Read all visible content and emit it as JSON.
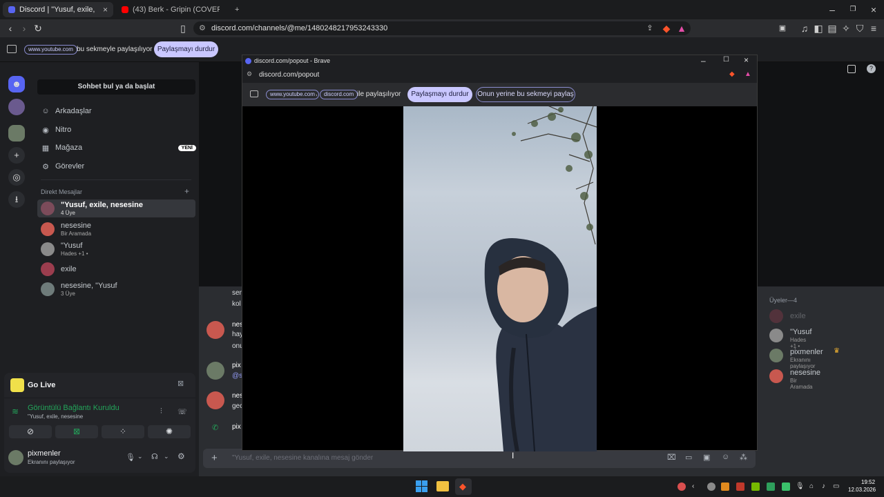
{
  "tabs": [
    {
      "title": "Discord | \"Yusuf, exile, nesesine",
      "active": true
    },
    {
      "title": "(43) Berk - Gripin (COVER) - YouT",
      "active": false
    }
  ],
  "browser": {
    "url": "discord.com/channels/@me/1480248217953243330"
  },
  "sharebar": {
    "site_pill": "www.youtube.com",
    "text": "bu sekmeyle paylaşılıyor",
    "stop_button": "Paylaşmayı durdur"
  },
  "sidebar": {
    "finder": "Sohbet bul ya da başlat",
    "nav": [
      "Arkadaşlar",
      "Nitro",
      "Mağaza",
      "Görevler"
    ],
    "new_badge": "YENİ",
    "dm_header": "Direkt Mesajlar",
    "dm_add": "+",
    "dms": [
      {
        "name": "\"Yusuf, exile, nesesine",
        "sub": "4 Üye"
      },
      {
        "name": "nesesine",
        "sub": "Bir Aramada"
      },
      {
        "name": "\"Yusuf",
        "sub": "Hades +1 •"
      },
      {
        "name": "exile",
        "sub": ""
      },
      {
        "name": "nesesine, \"Yusuf",
        "sub": "3 Üye"
      }
    ]
  },
  "golive": {
    "title": "Go Live",
    "status": "Görüntülü Bağlantı Kuruldu",
    "channel": "\"Yusuf, exile, nesesine"
  },
  "user": {
    "name": "pixmenler",
    "status": "Ekranını paylaşıyor"
  },
  "chat": {
    "snippets": [
      "sen",
      "kol",
      "nes",
      "hay",
      "onu",
      "pix",
      "@s",
      "nes",
      "gec",
      "pix"
    ],
    "input_placeholder": "\"Yusuf, exile, nesesine kanalına mesaj gönder"
  },
  "members": {
    "header": "Üyeler—4",
    "list": [
      {
        "name": "exile",
        "sub": ""
      },
      {
        "name": "\"Yusuf",
        "sub": "Hades +1 •"
      },
      {
        "name": "pixmenler",
        "sub": "Ekranını paylaşıyor"
      },
      {
        "name": "nesesine",
        "sub": "Bir Aramada"
      }
    ]
  },
  "popout": {
    "title": "discord.com/popout - Brave",
    "url": "discord.com/popout",
    "pill1": "www.youtube.com",
    "pill_sep": ",",
    "pill2": "discord.com",
    "share_text": "ile paylaşılıyor",
    "stop_button": "Paylaşmayı durdur",
    "share_this_tab": "Onun yerine bu sekmeyi paylaş"
  },
  "clock": {
    "time": "19:52",
    "date": "12.03.2026"
  },
  "colors": {
    "accent": "#5865f2",
    "online": "#23a55a",
    "share_button": "#c9c7ff"
  }
}
